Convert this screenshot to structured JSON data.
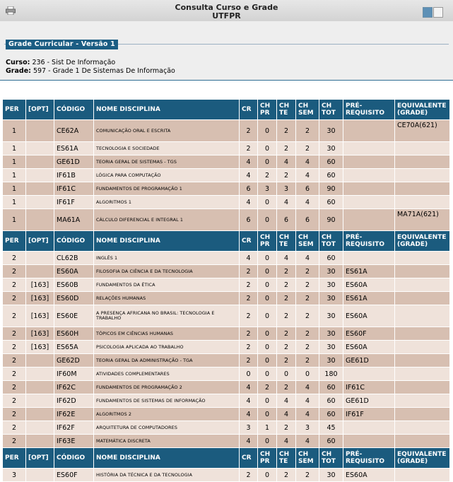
{
  "header": {
    "title_line1": "Consulta Curso e Grade",
    "title_line2": "UTFPR",
    "icons": [
      "printer-icon",
      "window-blue-icon",
      "window-white-icon"
    ]
  },
  "info": {
    "legend": "Grade Curricular - Versão 1",
    "curso_label": "Curso:",
    "curso_value": "236 - Sist De Informação",
    "grade_label": "Grade:",
    "grade_value": "597 - Grade 1 De Sistemas De Informação"
  },
  "table": {
    "headers": [
      "PER",
      "[OPT]",
      "CÓDIGO",
      "NOME DISCIPLINA",
      "CR",
      "CH PR",
      "CH TE",
      "CH SEM",
      "CH TOT",
      "PRÉ-REQUISITO",
      "EQUIVALENTE (GRADE)"
    ],
    "blocks": [
      [
        [
          "1",
          "",
          "CE62A",
          "COMUNICAÇÃO ORAL E ESCRITA",
          "2",
          "0",
          "2",
          "2",
          "30",
          "",
          "CE70A(621)"
        ],
        [
          "1",
          "",
          "ES61A",
          "TECNOLOGIA E SOCIEDADE",
          "2",
          "0",
          "2",
          "2",
          "30",
          "",
          ""
        ],
        [
          "1",
          "",
          "GE61D",
          "TEORIA GERAL DE SISTEMAS - TGS",
          "4",
          "0",
          "4",
          "4",
          "60",
          "",
          ""
        ],
        [
          "1",
          "",
          "IF61B",
          "LÓGICA PARA COMPUTAÇÃO",
          "4",
          "2",
          "2",
          "4",
          "60",
          "",
          ""
        ],
        [
          "1",
          "",
          "IF61C",
          "FUNDAMENTOS DE PROGRAMAÇÃO 1",
          "6",
          "3",
          "3",
          "6",
          "90",
          "",
          ""
        ],
        [
          "1",
          "",
          "IF61F",
          "ALGORITMOS 1",
          "4",
          "0",
          "4",
          "4",
          "60",
          "",
          ""
        ],
        [
          "1",
          "",
          "MA61A",
          "CÁLCULO DIFERENCIAL E INTEGRAL 1",
          "6",
          "0",
          "6",
          "6",
          "90",
          "",
          "MA71A(621)"
        ]
      ],
      [
        [
          "2",
          "",
          "CL62B",
          "INGLÊS 1",
          "4",
          "0",
          "4",
          "4",
          "60",
          "",
          ""
        ],
        [
          "2",
          "",
          "ES60A",
          "FILOSOFIA DA CIÊNCIA E DA TECNOLOGIA",
          "2",
          "0",
          "2",
          "2",
          "30",
          "ES61A",
          ""
        ],
        [
          "2",
          "[163]",
          "ES60B",
          "FUNDAMENTOS DA ÉTICA",
          "2",
          "0",
          "2",
          "2",
          "30",
          "ES60A",
          ""
        ],
        [
          "2",
          "[163]",
          "ES60D",
          "RELAÇÕES HUMANAS",
          "2",
          "0",
          "2",
          "2",
          "30",
          "ES61A",
          ""
        ],
        [
          "2",
          "[163]",
          "ES60E",
          "A PRESENÇA AFRICANA NO BRASIL: TECNOLOGIA E TRABALHO",
          "2",
          "0",
          "2",
          "2",
          "30",
          "ES60A",
          ""
        ],
        [
          "2",
          "[163]",
          "ES60H",
          "TÓPICOS EM CIÊNCIAS HUMANAS",
          "2",
          "0",
          "2",
          "2",
          "30",
          "ES60F",
          ""
        ],
        [
          "2",
          "[163]",
          "ES65A",
          "PSICOLOGIA APLICADA AO TRABALHO",
          "2",
          "0",
          "2",
          "2",
          "30",
          "ES60A",
          ""
        ],
        [
          "2",
          "",
          "GE62D",
          "TEORIA GERAL DA ADMINISTRAÇÃO - TGA",
          "2",
          "0",
          "2",
          "2",
          "30",
          "GE61D",
          ""
        ],
        [
          "2",
          "",
          "IF60M",
          "ATIVIDADES COMPLEMENTARES",
          "0",
          "0",
          "0",
          "0",
          "180",
          "",
          ""
        ],
        [
          "2",
          "",
          "IF62C",
          "FUNDAMENTOS DE PROGRAMAÇÃO 2",
          "4",
          "2",
          "2",
          "4",
          "60",
          "IF61C",
          ""
        ],
        [
          "2",
          "",
          "IF62D",
          "FUNDAMENTOS DE SISTEMAS DE INFORMAÇÃO",
          "4",
          "0",
          "4",
          "4",
          "60",
          "GE61D",
          ""
        ],
        [
          "2",
          "",
          "IF62E",
          "ALGORITMOS 2",
          "4",
          "0",
          "4",
          "4",
          "60",
          "IF61F",
          ""
        ],
        [
          "2",
          "",
          "IF62F",
          "ARQUITETURA DE COMPUTADORES",
          "3",
          "1",
          "2",
          "3",
          "45",
          "",
          ""
        ],
        [
          "2",
          "",
          "IF63E",
          "MATEMÁTICA DISCRETA",
          "4",
          "0",
          "4",
          "4",
          "60",
          "",
          ""
        ]
      ],
      [
        [
          "3",
          "",
          "ES60F",
          "HISTÓRIA DA TÉCNICA E DA TECNOLOGIA",
          "2",
          "0",
          "2",
          "2",
          "30",
          "ES60A",
          ""
        ]
      ]
    ]
  }
}
